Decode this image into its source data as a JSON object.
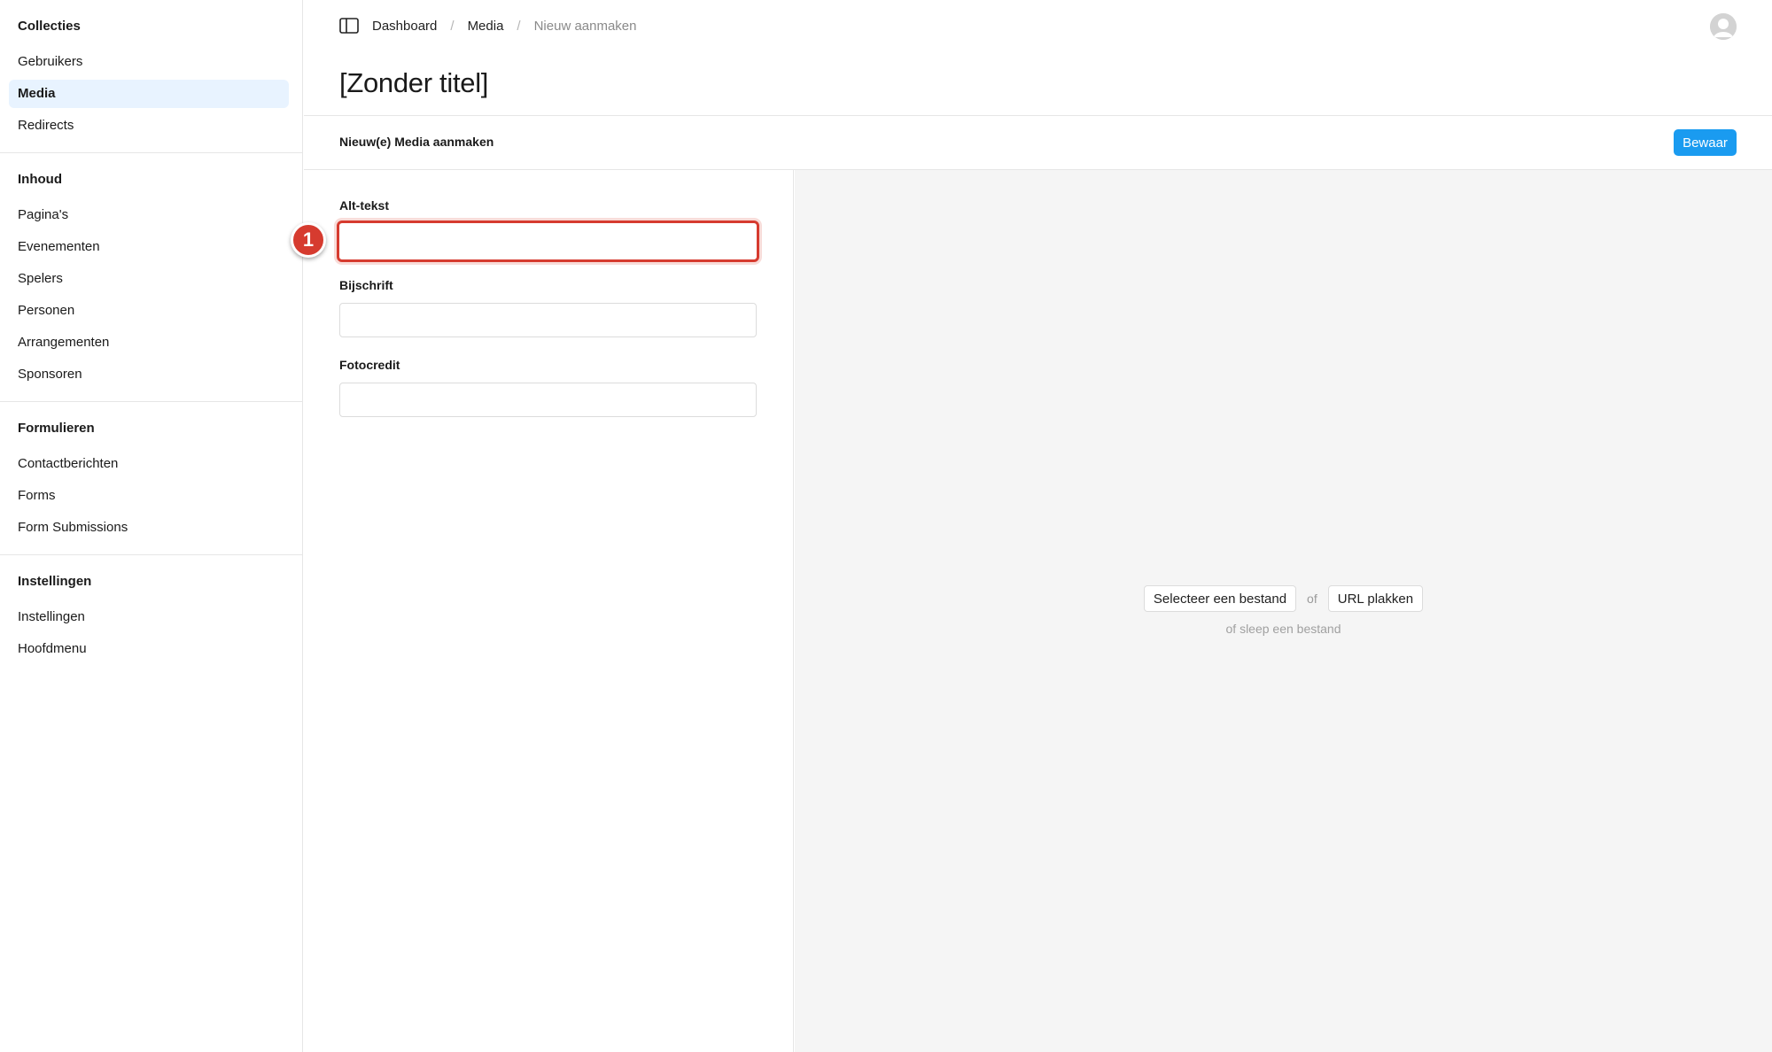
{
  "sidebar": {
    "groups": [
      {
        "title": "Collecties",
        "items": [
          {
            "label": "Gebruikers"
          },
          {
            "label": "Media"
          },
          {
            "label": "Redirects"
          }
        ]
      },
      {
        "title": "Inhoud",
        "items": [
          {
            "label": "Pagina's"
          },
          {
            "label": "Evenementen"
          },
          {
            "label": "Spelers"
          },
          {
            "label": "Personen"
          },
          {
            "label": "Arrangementen"
          },
          {
            "label": "Sponsoren"
          }
        ]
      },
      {
        "title": "Formulieren",
        "items": [
          {
            "label": "Contactberichten"
          },
          {
            "label": "Forms"
          },
          {
            "label": "Form Submissions"
          }
        ]
      },
      {
        "title": "Instellingen",
        "items": [
          {
            "label": "Instellingen"
          },
          {
            "label": "Hoofdmenu"
          }
        ]
      }
    ],
    "active_item": "Media"
  },
  "breadcrumb": {
    "items": [
      "Dashboard",
      "Media",
      "Nieuw aanmaken"
    ],
    "separator": "/"
  },
  "page": {
    "title": "[Zonder titel]"
  },
  "action_bar": {
    "label": "Nieuw(e) Media aanmaken",
    "save_label": "Bewaar"
  },
  "form": {
    "fields": [
      {
        "label": "Alt-tekst",
        "value": ""
      },
      {
        "label": "Bijschrift",
        "value": ""
      },
      {
        "label": "Fotocredit",
        "value": ""
      }
    ],
    "marker_number": "1"
  },
  "upload": {
    "select_label": "Selecteer een bestand",
    "or_label": "of",
    "url_label": "URL plakken",
    "drop_hint": "of sleep een bestand"
  },
  "colors": {
    "accent": "#1a9bf0",
    "active_nav_bg": "#e8f3ff",
    "marker": "#d63b2f",
    "upload_bg": "#f5f5f5"
  },
  "icons": {
    "sidebar_toggle": "sidebar-toggle-icon",
    "avatar": "user-avatar-icon"
  }
}
